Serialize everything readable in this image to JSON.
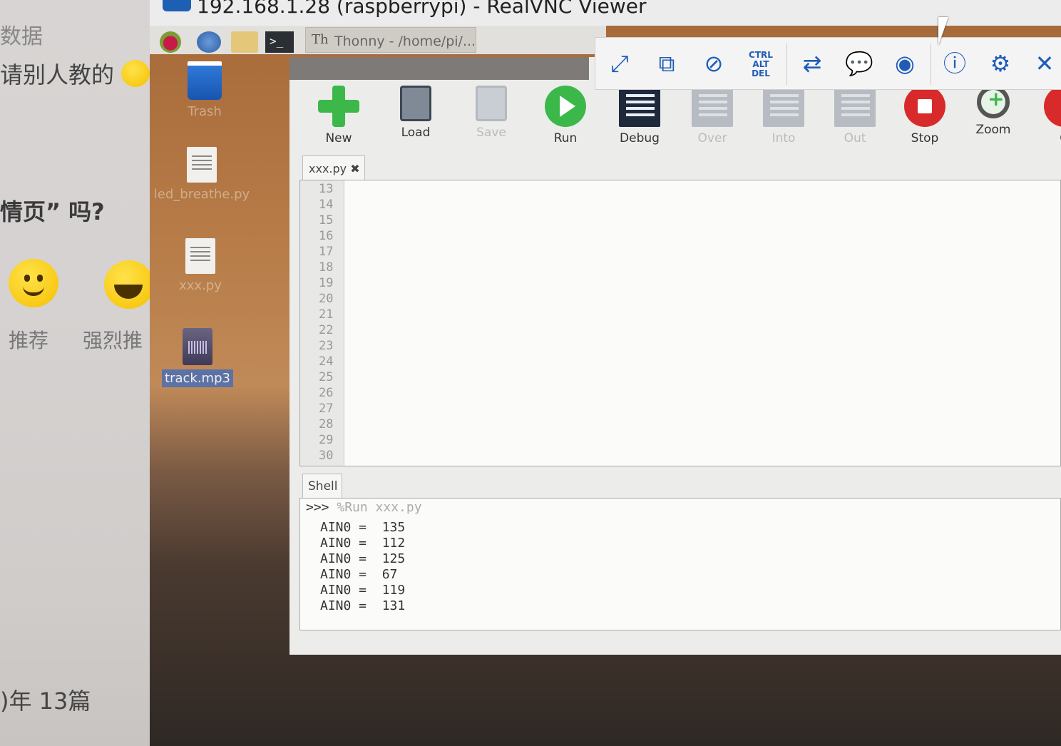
{
  "background_page": {
    "line1": "数据",
    "line2": "请别人教的",
    "line3": "情页” 吗?",
    "reaction_1": "推荐",
    "reaction_2": "强烈推",
    "footer": ")年  13篇"
  },
  "window": {
    "title": "192.168.1.28 (raspberrypi) - RealVNC Viewer"
  },
  "taskbar": {
    "task_label": "Thonny  -  /home/pi/...",
    "terminal_glyph": ">_"
  },
  "desktop_icons": [
    {
      "label": "Trash"
    },
    {
      "label": "led_breathe.py"
    },
    {
      "label": "xxx.py"
    },
    {
      "label": "track.mp3"
    }
  ],
  "vnc_toolbar": {
    "buttons": [
      "fullscreen-icon",
      "scale-icon",
      "mute-icon",
      "ctrl-alt-del-icon",
      "transfer-icon",
      "chat-icon",
      "record-icon",
      "info-icon",
      "settings-icon",
      "close-icon"
    ],
    "cad_text": "CTRL ALT DEL"
  },
  "thonny": {
    "tools": {
      "new": "New",
      "load": "Load",
      "save": "Save",
      "run": "Run",
      "debug": "Debug",
      "over": "Over",
      "into": "Into",
      "out": "Out",
      "stop": "Stop",
      "zoom": "Zoom",
      "quit": "Q"
    },
    "editor_tab": "xxx.py",
    "tab_close": "✖",
    "shell_tab": "Shell",
    "line_numbers": [
      "13",
      "14",
      "15",
      "16",
      "17",
      "18",
      "19",
      "20",
      "21",
      "22",
      "23",
      "24",
      "25",
      "26",
      "27",
      "28",
      "29",
      "30"
    ],
    "shell_prompt": ">>>",
    "shell_command": "%Run xxx.py",
    "shell_output": [
      "AIN0 =  135",
      "AIN0 =  112",
      "AIN0 =  125",
      "AIN0 =  67",
      "AIN0 =  119",
      "AIN0 =  131"
    ]
  },
  "colors": {
    "accent": "#1f5cb8",
    "run_green": "#3cb84a",
    "stop_red": "#d82a2a"
  }
}
